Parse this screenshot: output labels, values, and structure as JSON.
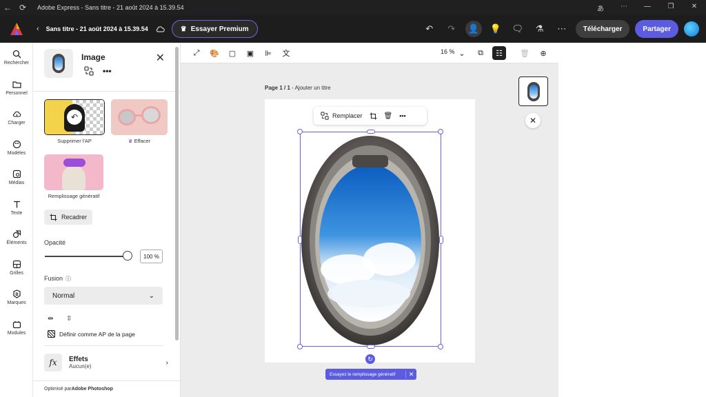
{
  "window": {
    "title": "Adobe Express - Sans titre - 21 août 2024 à 15.39.54"
  },
  "header": {
    "doc_title": "Sans titre - 21 août 2024 à 15.39.54",
    "premium_label": "Essayer Premium",
    "download_label": "Télécharger",
    "share_label": "Partager"
  },
  "rail": {
    "items": [
      {
        "label": "Rechercher",
        "icon": "search-icon"
      },
      {
        "label": "Personnel",
        "icon": "folder-icon"
      },
      {
        "label": "Charger",
        "icon": "upload-icon"
      },
      {
        "label": "Modèles",
        "icon": "templates-icon"
      },
      {
        "label": "Médias",
        "icon": "media-icon"
      },
      {
        "label": "Texte",
        "icon": "text-icon"
      },
      {
        "label": "Éléments",
        "icon": "elements-icon"
      },
      {
        "label": "Grilles",
        "icon": "grid-icon"
      },
      {
        "label": "Marques",
        "icon": "brand-icon"
      },
      {
        "label": "Modules",
        "icon": "addons-icon"
      }
    ]
  },
  "panel": {
    "title": "Image",
    "cards": {
      "remove_bg": "Supprimer l'AP",
      "erase": "Effacer",
      "generative_fill": "Remplissage génératif"
    },
    "crop_label": "Recadrer",
    "opacity_label": "Opacité",
    "opacity_value": "100 %",
    "opacity_fraction": 1.0,
    "blend_label": "Fusion",
    "blend_value": "Normal",
    "set_bg_label": "Définir comme AP de la page",
    "effects_label": "Effets",
    "effects_value": "Aucun(e)",
    "footer_prefix": "Optimisé par ",
    "footer_brand": "Adobe Photoshop"
  },
  "canvas": {
    "zoom": "16 %",
    "page_label_bold": "Page 1 / 1",
    "page_label_rest": " - Ajouter un titre",
    "context_replace": "Remplacer",
    "toast_text": "Essayez le remplissage génératif"
  },
  "colors": {
    "accent": "#5c5ce0",
    "selection": "#6a5ee0",
    "header_bg": "#1d1d1d"
  }
}
